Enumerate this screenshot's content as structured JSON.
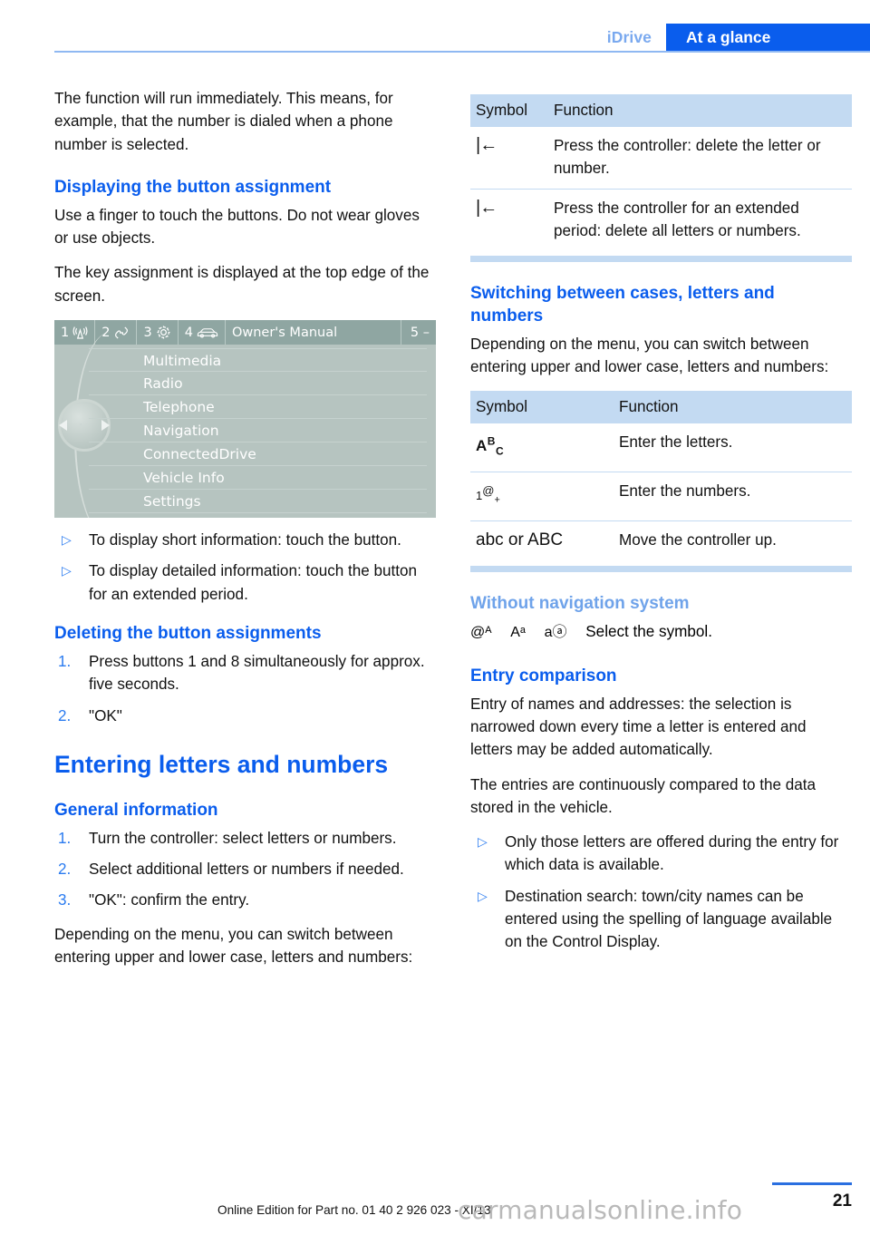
{
  "header": {
    "chapter": "iDrive",
    "section": "At a glance"
  },
  "left_column": {
    "intro_paragraph": "The function will run immediately. This means, for example, that the number is dialed when a phone number is selected.",
    "heading_displaying": "Displaying the button assignment",
    "para_touch": "Use a finger to touch the buttons. Do not wear gloves or use objects.",
    "para_keyassign": "The key assignment is displayed at the top edge of the screen.",
    "idrive": {
      "bar_items": [
        {
          "number": "1",
          "icon": "radio-waves-icon"
        },
        {
          "number": "2",
          "icon": "phone-handset-icon"
        },
        {
          "number": "3",
          "icon": "gear-icon"
        },
        {
          "number": "4",
          "icon": "car-icon"
        }
      ],
      "title": "Owner's Manual",
      "right_label": "5 –",
      "menu_items": [
        "Multimedia",
        "Radio",
        "Telephone",
        "Navigation",
        "ConnectedDrive",
        "Vehicle Info",
        "Settings"
      ]
    },
    "bullets_display": [
      "To display short information: touch the button.",
      "To display detailed information: touch the button for an extended period."
    ],
    "heading_deleting": "Deleting the button assignments",
    "steps_deleting": [
      {
        "num": "1.",
        "text": "Press buttons 1 and 8 simultaneously for approx. five seconds."
      },
      {
        "num": "2.",
        "text": "\"OK\""
      }
    ],
    "chapter_title": "Entering letters and numbers",
    "heading_general": "General information",
    "steps_general": [
      {
        "num": "1.",
        "text": "Turn the controller: select letters or numbers."
      },
      {
        "num": "2.",
        "text": "Select additional letters or numbers if needed."
      },
      {
        "num": "3.",
        "text": "\"OK\": confirm the entry."
      }
    ],
    "para_depending": "Depending on the menu, you can switch between entering upper and lower case, letters and numbers:"
  },
  "right_column": {
    "table_delete": {
      "headers": [
        "Symbol",
        "Function"
      ],
      "rows": [
        {
          "symbol": "|←",
          "symbol_name": "backspace-icon",
          "function": "Press the controller: delete the letter or number."
        },
        {
          "symbol": "|←",
          "symbol_name": "backspace-icon",
          "function": "Press the controller for an extended period: delete all letters or numbers."
        }
      ]
    },
    "heading_switching": "Switching between cases, letters and numbers",
    "para_depending": "Depending on the menu, you can switch between entering upper and lower case, letters and numbers:",
    "table_cases": {
      "headers": [
        "Symbol",
        "Function"
      ],
      "rows": [
        {
          "symbol": "ABC",
          "symbol_name": "mixed-case-icon",
          "function": "Enter the letters."
        },
        {
          "symbol": "1@+",
          "symbol_name": "numbers-symbols-icon",
          "function": "Enter the numbers."
        },
        {
          "symbol": "abc or ABC",
          "symbol_name": "case-toggle-icon",
          "function": "Move the controller up."
        }
      ]
    },
    "heading_without_nav": "Without navigation system",
    "nav_symbols": [
      "@ᴬ",
      "Aᵃ",
      "aⓐ"
    ],
    "nav_symbols_text": "Select the symbol.",
    "heading_entry_comparison": "Entry comparison",
    "para_entry": "Entry of names and addresses: the selection is narrowed down every time a letter is entered and letters may be added automatically.",
    "para_compared": "The entries are continuously compared to the data stored in the vehicle.",
    "bullets_entry": [
      "Only those letters are offered during the entry for which data is available.",
      "Destination search: town/city names can be entered using the spelling of language available on the Control Display."
    ]
  },
  "footer": {
    "online_edition": "Online Edition for Part no. 01 40 2 926 023 - XI/13",
    "page_number": "21",
    "watermark": "carmanualsonline.info"
  },
  "colors": {
    "accent_blue": "#0a5ded",
    "light_blue": "#6fa3ea",
    "table_header_blue": "#c3daf2",
    "idrive_bg": "#b6c4c0",
    "idrive_bar": "#8fa6a2"
  }
}
